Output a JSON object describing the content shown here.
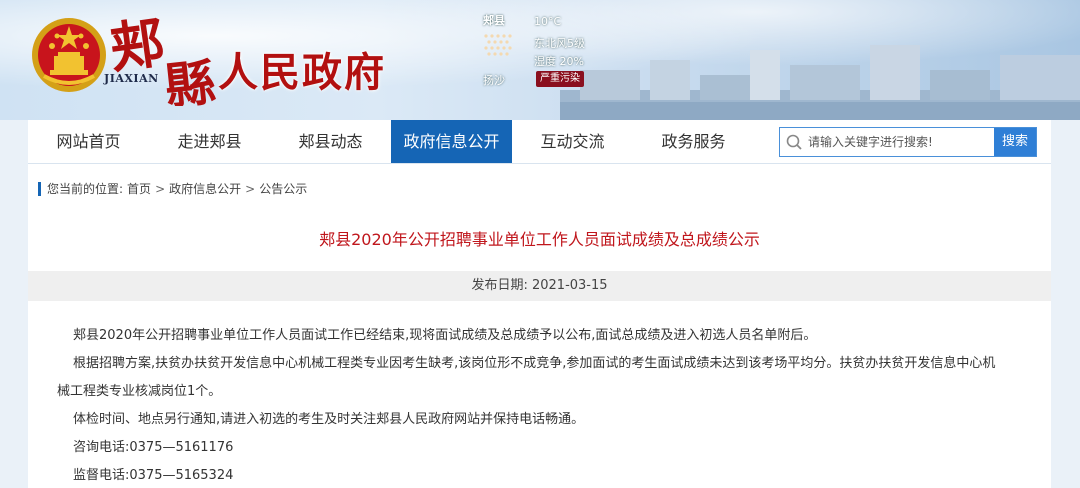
{
  "header": {
    "logo_pinyin": "JIAXIAN",
    "site_title": "人民政府",
    "logo_characters": "郏縣",
    "weather": {
      "city": "郏县",
      "temperature": "10°C",
      "wind": "东北风5级",
      "humidity": "湿度 20%",
      "condition": "扬沙",
      "air_quality": "严重污染",
      "icon": "sandstorm-icon"
    }
  },
  "nav": {
    "items": [
      {
        "label": "网站首页"
      },
      {
        "label": "走进郏县"
      },
      {
        "label": "郏县动态"
      },
      {
        "label": "政府信息公开"
      },
      {
        "label": "互动交流"
      },
      {
        "label": "政务服务"
      }
    ],
    "active_index": 3,
    "search_placeholder": "请输入关键字进行搜索!",
    "search_button": "搜索"
  },
  "breadcrumb": {
    "prefix": "您当前的位置:",
    "items": [
      "首页",
      "政府信息公开",
      "公告公示"
    ],
    "separator": ">"
  },
  "article": {
    "title": "郏县2020年公开招聘事业单位工作人员面试成绩及总成绩公示",
    "date": "发布日期:  2021-03-15",
    "paragraphs": [
      "郏县2020年公开招聘事业单位工作人员面试工作已经结束,现将面试成绩及总成绩予以公布,面试总成绩及进入初选人员名单附后。",
      "根据招聘方案,扶贫办扶贫开发信息中心机械工程类专业因考生缺考,该岗位形不成竞争,参加面试的考生面试成绩未达到该考场平均分。扶贫办扶贫开发信息中心机",
      "械工程类专业核减岗位1个。",
      "体检时间、地点另行通知,请进入初选的考生及时关注郏县人民政府网站并保持电话畅通。",
      "咨询电话:0375—5161176",
      "监督电话:0375—5165324"
    ]
  },
  "colors": {
    "primary_blue": "#1565b5",
    "title_red": "#c0161c",
    "brand_red": "#b21010"
  }
}
